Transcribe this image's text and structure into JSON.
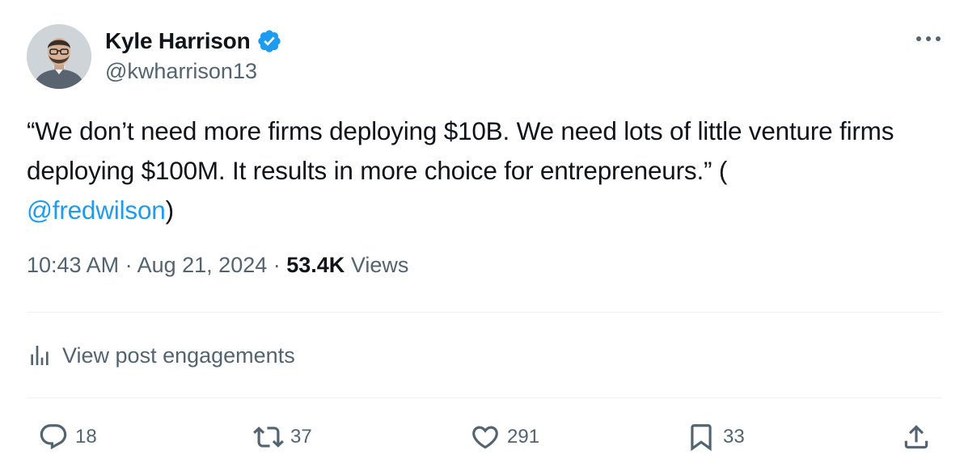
{
  "author": {
    "name": "Kyle Harrison",
    "handle": "@kwharrison13",
    "avatar_icon": "avatar-photo",
    "verified_icon": "verified-badge-icon",
    "verified_color": "#1d9bf0"
  },
  "menu_icon": "more-horizontal-icon",
  "post": {
    "text_before": "“We don’t need more firms deploying $10B. We need lots of little venture firms deploying $100M. It results in more choice for entrepreneurs.” (",
    "mention": "@fredwilson",
    "text_after": ")"
  },
  "meta": {
    "time": "10:43 AM",
    "separator1": " · ",
    "date": "Aug 21, 2024",
    "separator2": " · ",
    "views_count": "53.4K",
    "views_label": "Views"
  },
  "engagements": {
    "label": "View post engagements",
    "icon": "analytics-bars-icon"
  },
  "actions": {
    "replies": "18",
    "reposts": "37",
    "likes": "291",
    "bookmarks": "33"
  },
  "colors": {
    "text_primary": "#0f1419",
    "text_secondary": "#536471",
    "link": "#1d9bf0",
    "divider": "#eff3f4"
  }
}
